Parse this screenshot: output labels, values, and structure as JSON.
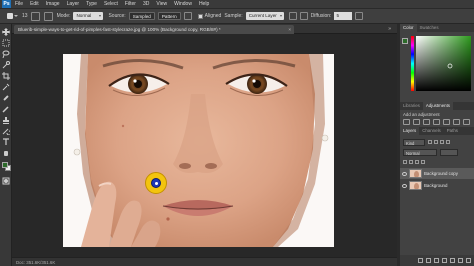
{
  "app": {
    "logo": "Ps"
  },
  "menu": [
    "File",
    "Edit",
    "Image",
    "Layer",
    "Type",
    "Select",
    "Filter",
    "3D",
    "View",
    "Window",
    "Help"
  ],
  "options": {
    "brush_size": "13",
    "mode_label": "Mode:",
    "mode_value": "Normal",
    "source_label": "Source:",
    "source_sampled": "Sampled",
    "source_pattern": "Pattern",
    "aligned_label": "Aligned",
    "sample_label": "Sample:",
    "sample_value": "Current Layer",
    "diffusion_label": "Diffusion:",
    "diffusion_value": "5"
  },
  "document": {
    "tab_title": "Bluerib-simple-ways-to-get-rid-of-pimples-fast-stylecraze.jpg @ 100% (Background copy, RGB/8#) *",
    "status": "Doc: 351.6K/351.6K"
  },
  "panels": {
    "color_tabs": [
      "Color",
      "Swatches"
    ],
    "adjust_tabs": [
      "Libraries",
      "Adjustments"
    ],
    "adjust_title": "Add an adjustment",
    "layers_tabs": [
      "Layers",
      "Channels",
      "Paths"
    ],
    "layers_kind": "Kind",
    "layers_blend": "Normal",
    "layers": [
      {
        "name": "Background copy",
        "selected": true
      },
      {
        "name": "Background",
        "selected": false
      }
    ]
  },
  "colors": {
    "foreground": "#2c6a2a",
    "background": "#ffffff",
    "cursor_ring": "#f3c40e",
    "cursor_center": "#1e38b8"
  }
}
